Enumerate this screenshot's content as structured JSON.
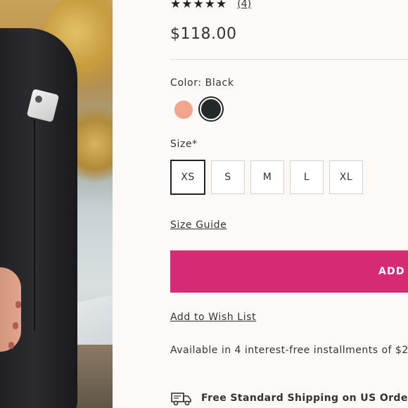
{
  "product": {
    "rating_stars": "★★★★★",
    "review_count": "(4)",
    "price": "$118.00",
    "color_label": "Color: Black",
    "colors": [
      {
        "name": "peach",
        "hex": "#f1a58c"
      },
      {
        "name": "black",
        "hex": "#24292a",
        "selected": true
      }
    ],
    "size_label": "Size*",
    "sizes": [
      "XS",
      "S",
      "M",
      "L",
      "XL"
    ],
    "selected_size": "XS",
    "size_guide": "Size Guide",
    "add_button": "ADD T",
    "wish_list": "Add to Wish List",
    "installments": "Available in 4 interest-free installments of $2",
    "shipping": "Free Standard Shipping on US Orders"
  },
  "theme": {
    "accent": "#d72a74",
    "background": "#fdf9f7"
  }
}
